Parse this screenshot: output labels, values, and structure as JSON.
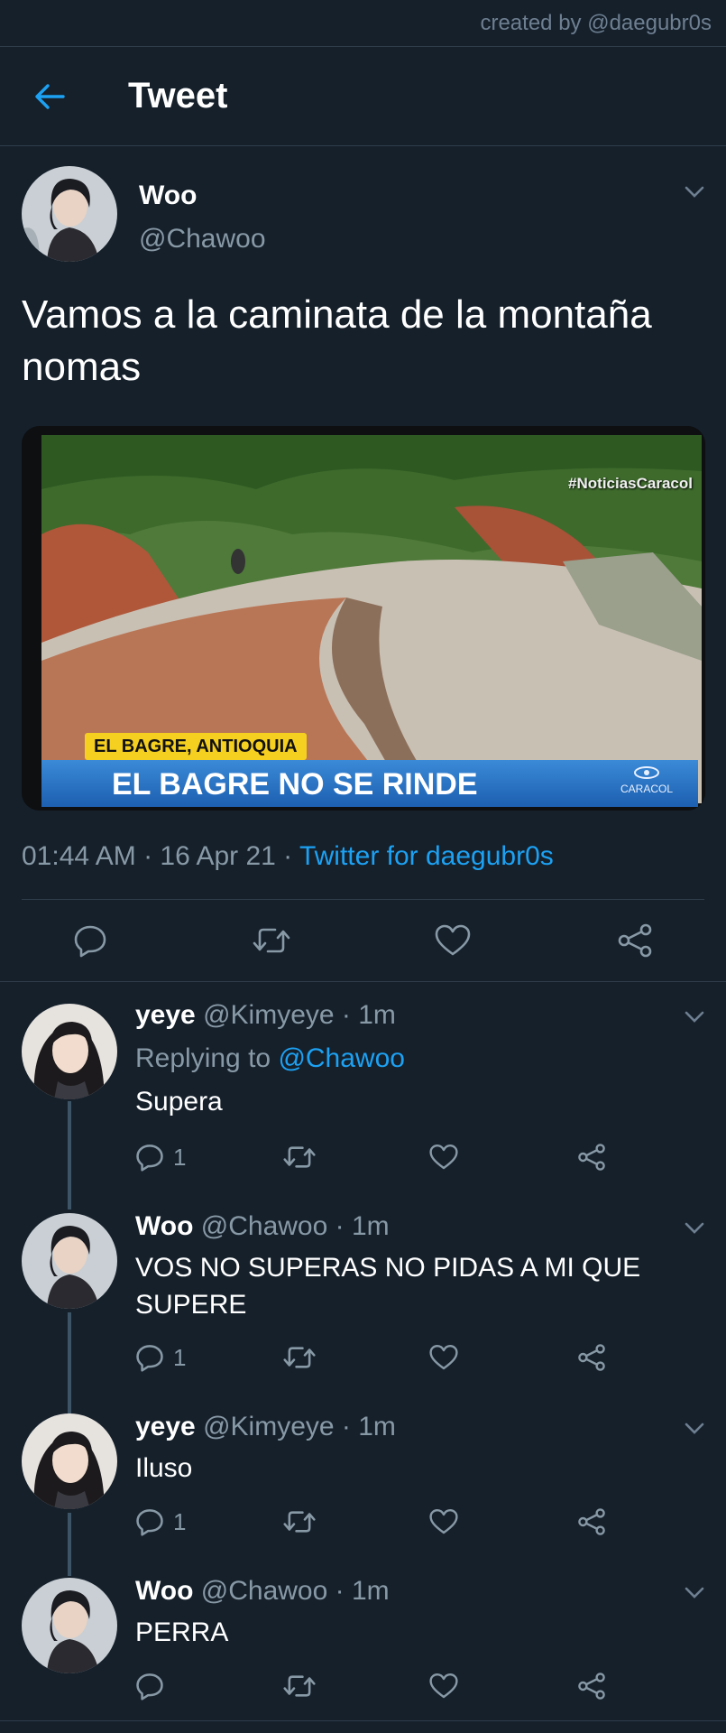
{
  "watermark": "created by @daegubr0s",
  "header": {
    "title": "Tweet",
    "back_icon": "arrow-left-icon"
  },
  "colors": {
    "background": "#15202b",
    "accent": "#1da1f2",
    "muted": "#8899a6",
    "divider": "#2f3c4a"
  },
  "tweet": {
    "name": "Woo",
    "handle": "@Chawoo",
    "text": "Vamos a la caminata de la montaña nomas",
    "media": {
      "hashtag": "#NoticiasCaracol",
      "location": "EL BAGRE, ANTIOQUIA",
      "headline": "EL BAGRE NO SE RINDE",
      "logo": "CARACOL"
    },
    "time": "01:44 AM · 16 Apr 21 · ",
    "source": "Twitter for daegubr0s"
  },
  "replies": [
    {
      "name": "yeye",
      "handle": "@Kimyeye · 1m",
      "replying_to_label": "Replying to ",
      "replying_to": "@Chawoo",
      "text": "Supera",
      "reply_count": "1"
    },
    {
      "name": "Woo",
      "handle": "@Chawoo · 1m",
      "text": "VOS NO SUPERAS NO PIDAS A MI QUE SUPERE",
      "reply_count": "1"
    },
    {
      "name": "yeye",
      "handle": "@Kimyeye · 1m",
      "text": "Iluso",
      "reply_count": "1"
    },
    {
      "name": "Woo",
      "handle": "@Chawoo · 1m",
      "text": "PERRA",
      "reply_count": ""
    }
  ]
}
